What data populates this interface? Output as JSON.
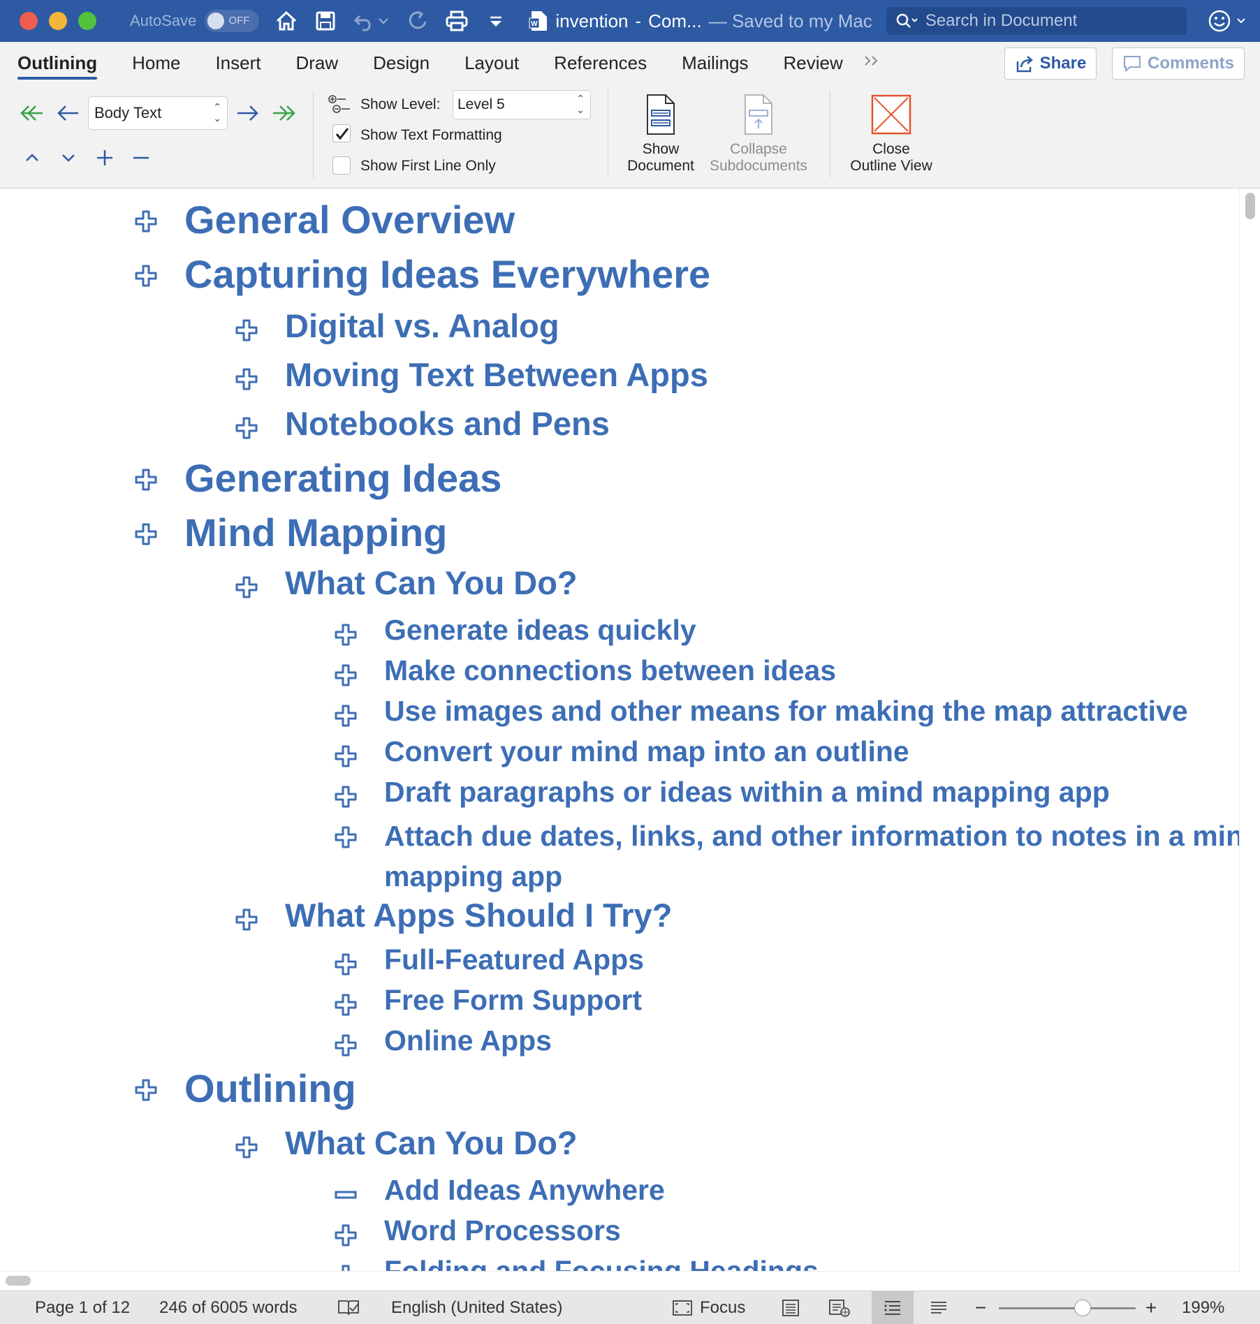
{
  "titlebar": {
    "autosave_label": "AutoSave",
    "autosave_state": "OFF",
    "doc_name": "invention",
    "doc_sep": "-",
    "doc_short": "Com...",
    "saved_text": "— Saved to my Mac",
    "search_placeholder": "Search in Document",
    "bg_color": "#2d5aa3"
  },
  "tabs": [
    {
      "label": "Outlining",
      "active": true
    },
    {
      "label": "Home"
    },
    {
      "label": "Insert"
    },
    {
      "label": "Draw"
    },
    {
      "label": "Design"
    },
    {
      "label": "Layout"
    },
    {
      "label": "References"
    },
    {
      "label": "Mailings"
    },
    {
      "label": "Review"
    }
  ],
  "tab_actions": {
    "share_label": "Share",
    "comments_label": "Comments"
  },
  "ribbon": {
    "style_value": "Body Text",
    "show_level_label": "Show Level:",
    "show_level_value": "Level 5",
    "show_text_formatting_label": "Show Text Formatting",
    "show_text_formatting_checked": true,
    "show_first_line_label": "Show First Line Only",
    "show_first_line_checked": false,
    "show_document_label_1": "Show",
    "show_document_label_2": "Document",
    "collapse_label_1": "Collapse",
    "collapse_label_2": "Subdocuments",
    "close_label_1": "Close",
    "close_label_2": "Outline View"
  },
  "outline": [
    {
      "level": 1,
      "text": "General Overview",
      "symbol": "plus"
    },
    {
      "level": 1,
      "text": "Capturing Ideas Everywhere",
      "symbol": "plus"
    },
    {
      "level": 2,
      "text": "Digital vs. Analog",
      "symbol": "plus"
    },
    {
      "level": 2,
      "text": "Moving Text Between Apps",
      "symbol": "plus"
    },
    {
      "level": 2,
      "text": "Notebooks and Pens",
      "symbol": "plus"
    },
    {
      "level": 1,
      "text": "Generating Ideas",
      "symbol": "plus"
    },
    {
      "level": 1,
      "text": "Mind Mapping",
      "symbol": "plus"
    },
    {
      "level": 2,
      "text": "What Can You Do?",
      "symbol": "plus"
    },
    {
      "level": 3,
      "text": "Generate ideas quickly",
      "symbol": "plus"
    },
    {
      "level": 3,
      "text": "Make connections between ideas",
      "symbol": "plus"
    },
    {
      "level": 3,
      "text": "Use images and other means for making the map attractive",
      "symbol": "plus"
    },
    {
      "level": 3,
      "text": "Convert your mind map into an outline",
      "symbol": "plus"
    },
    {
      "level": 3,
      "text": "Draft paragraphs or ideas within a mind mapping app",
      "symbol": "plus"
    },
    {
      "level": 3,
      "text": "Attach due dates, links, and other information to notes in a mind mapping app",
      "symbol": "plus"
    },
    {
      "level": 2,
      "text": "What Apps Should I Try?",
      "symbol": "plus"
    },
    {
      "level": 3,
      "text": "Full-Featured Apps",
      "symbol": "plus"
    },
    {
      "level": 3,
      "text": "Free Form Support",
      "symbol": "plus"
    },
    {
      "level": 3,
      "text": "Online Apps",
      "symbol": "plus"
    },
    {
      "level": 1,
      "text": "Outlining",
      "symbol": "plus"
    },
    {
      "level": 2,
      "text": "What Can You Do?",
      "symbol": "plus"
    },
    {
      "level": 3,
      "text": "Add Ideas Anywhere",
      "symbol": "minus"
    },
    {
      "level": 3,
      "text": "Word Processors",
      "symbol": "plus"
    },
    {
      "level": 3,
      "text": "Folding and Focusing Headings",
      "symbol": "plus"
    }
  ],
  "outline_color": "#3d6eb5",
  "status": {
    "page": "Page 1 of 12",
    "words": "246 of 6005 words",
    "language": "English (United States)",
    "focus_label": "Focus",
    "zoom": "199%"
  }
}
